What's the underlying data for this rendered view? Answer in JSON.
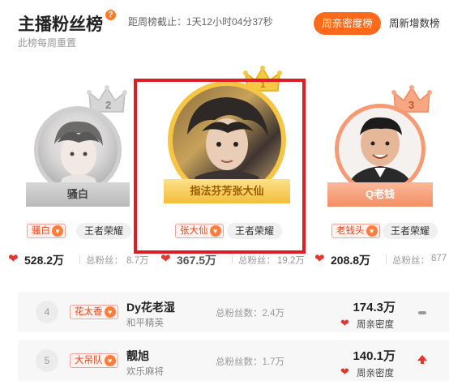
{
  "header": {
    "title": "主播粉丝榜",
    "help_icon": "question-icon",
    "countdown": "距周榜截止：1天12小时04分37秒",
    "subtitle": "此榜每周重置",
    "tab_active": "周亲密度榜",
    "tab_other": "周新增数榜"
  },
  "podium": [
    {
      "rank": "2",
      "ribbon": "骚白",
      "badge": "骚白",
      "game": "王者荣耀",
      "value": "528.2万",
      "fans_label": "总粉丝：",
      "fans": "8.7万"
    },
    {
      "rank": "1",
      "ribbon": "指法芬芳张大仙",
      "badge": "张大仙",
      "game": "王者荣耀",
      "value": "367.5万",
      "fans_label": "总粉丝：",
      "fans": "19.2万"
    },
    {
      "rank": "3",
      "ribbon": "Q老钱",
      "badge": "老钱头",
      "game": "王者荣耀",
      "value": "208.8万",
      "fans_label": "总粉丝：",
      "fans": "877"
    }
  ],
  "list": [
    {
      "rank": "4",
      "badge": "花太香",
      "name": "Dy花老湿",
      "game": "和平精英",
      "fans": "总粉丝数：2.4万",
      "value": "174.3万",
      "value_label": "周亲密度",
      "trend": "flat"
    },
    {
      "rank": "5",
      "badge": "大吊队",
      "name": "靓旭",
      "game": "欢乐麻将",
      "fans": "总粉丝数：1.7万",
      "value": "140.1万",
      "value_label": "周亲密度",
      "trend": "up"
    }
  ],
  "colors": {
    "accent": "#ff6a1a",
    "gold": "#f6c543",
    "silver": "#c9c9c9",
    "bronze": "#f59a74",
    "highlight": "#e01b24"
  }
}
